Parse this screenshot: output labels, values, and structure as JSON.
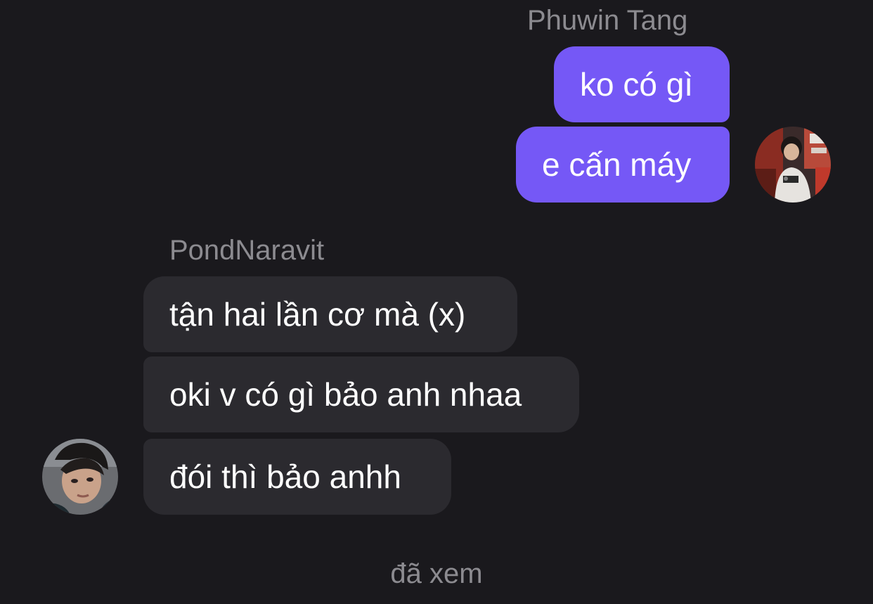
{
  "conversation": {
    "outgoing_group": {
      "sender_name": "Phuwin Tang",
      "messages": [
        {
          "text": "ko có gì"
        },
        {
          "text": "e cấn máy"
        }
      ]
    },
    "incoming_group": {
      "sender_name": "PondNaravit",
      "messages": [
        {
          "text": "tận hai lần cơ mà (x)"
        },
        {
          "text": "oki v có gì bảo anh nhaa"
        },
        {
          "text": "đói thì bảo anhh"
        }
      ]
    },
    "read_receipt": "đã xem"
  },
  "colors": {
    "background": "#1a191d",
    "outgoing_bubble": "#7558f6",
    "incoming_bubble": "#2b2a2f",
    "secondary_text": "#8c8b90",
    "primary_text": "#ffffff"
  }
}
